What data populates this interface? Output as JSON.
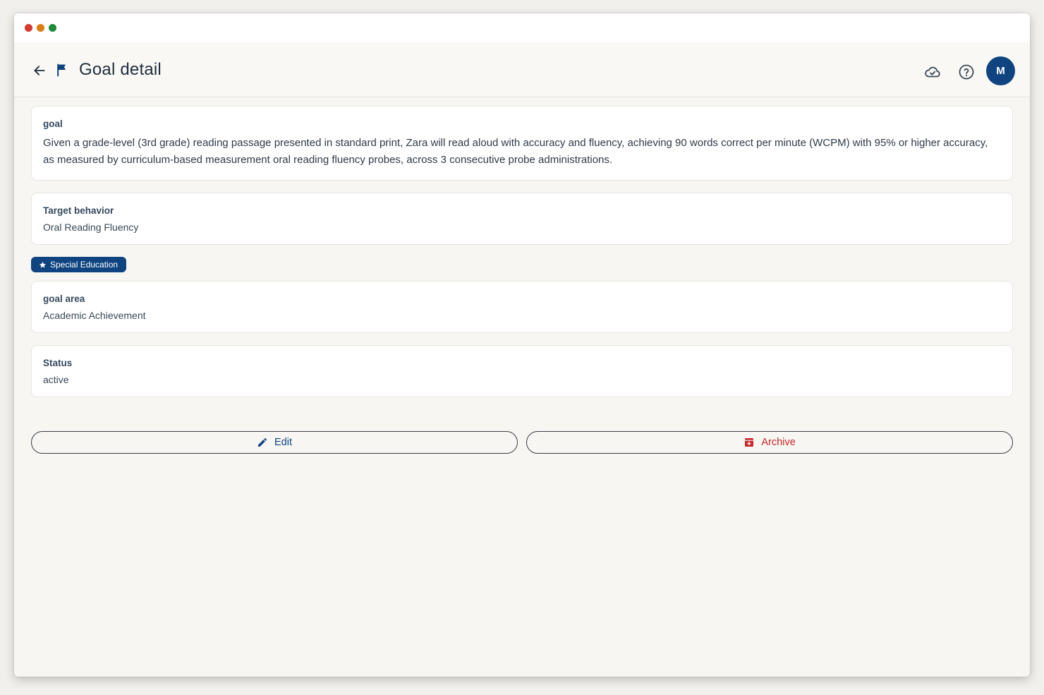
{
  "window": {
    "controls": [
      "close",
      "minimize",
      "maximize"
    ],
    "control_colors": [
      "#d63a2f",
      "#e07b12",
      "#1f8a3a"
    ]
  },
  "header": {
    "title": "Goal detail",
    "back_icon": "arrow-left-icon",
    "title_icon": "flag-icon",
    "sync_icon": "cloud-check-icon",
    "help_icon": "help-circle-icon",
    "avatar_initial": "M"
  },
  "cards": {
    "goal": {
      "label": "goal",
      "value": "Given a grade-level (3rd grade) reading passage presented in standard print, Zara will read aloud with accuracy and fluency, achieving 90 words correct per minute (WCPM) with 95% or higher accuracy, as measured by curriculum-based measurement oral reading fluency probes, across 3 consecutive probe administrations."
    },
    "target_behavior": {
      "label": "Target behavior",
      "value": "Oral Reading Fluency"
    },
    "chip": {
      "label": "Special Education",
      "icon": "star-icon"
    },
    "goal_area": {
      "label": "goal area",
      "value": "Academic Achievement"
    },
    "status": {
      "label": "Status",
      "value": "active"
    }
  },
  "actions": {
    "edit_label": "Edit",
    "edit_icon": "pencil-icon",
    "archive_label": "Archive",
    "archive_icon": "archive-icon"
  },
  "colors": {
    "primary": "#0f4480",
    "danger": "#c62828",
    "background": "#f7f6f3"
  }
}
